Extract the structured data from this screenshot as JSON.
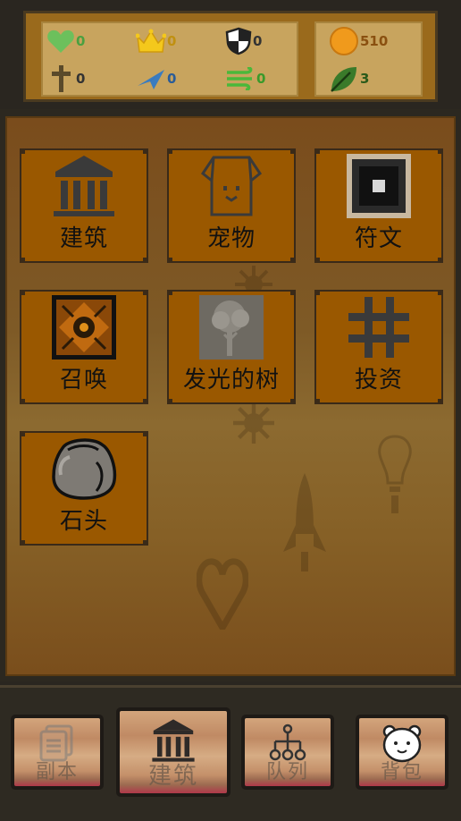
{
  "stats": {
    "health": {
      "icon": "heart-icon",
      "value": "0",
      "color": "#6cc05c"
    },
    "crown": {
      "icon": "crown-icon",
      "value": "0",
      "color": "#f4c81c"
    },
    "shield": {
      "icon": "shield-icon",
      "value": "0"
    },
    "sword": {
      "icon": "sword-icon",
      "value": "0"
    },
    "speed": {
      "icon": "paper-plane-icon",
      "value": "0",
      "color": "#3a7cc0"
    },
    "wind": {
      "icon": "wind-icon",
      "value": "0",
      "color": "#4ab83a"
    },
    "gold": {
      "icon": "gold-coin-icon",
      "value": "510",
      "color": "#f09a1c"
    },
    "leaf": {
      "icon": "leaf-icon",
      "value": "3",
      "color": "#3a7a2a"
    }
  },
  "menu": [
    {
      "label": "建筑",
      "icon": "building-icon"
    },
    {
      "label": "宠物",
      "icon": "pet-icon"
    },
    {
      "label": "符文",
      "icon": "rune-icon"
    },
    {
      "label": "召唤",
      "icon": "summon-icon"
    },
    {
      "label": "发光的树",
      "icon": "glowing-tree-icon"
    },
    {
      "label": "投资",
      "icon": "invest-icon"
    },
    {
      "label": "石头",
      "icon": "stone-icon"
    }
  ],
  "nav": [
    {
      "label": "副本",
      "icon": "dungeon-icon",
      "active": false
    },
    {
      "label": "建筑",
      "icon": "building-icon",
      "active": true
    },
    {
      "label": "队列",
      "icon": "queue-icon",
      "active": false
    },
    {
      "label": "背包",
      "icon": "backpack-icon",
      "active": false
    }
  ]
}
